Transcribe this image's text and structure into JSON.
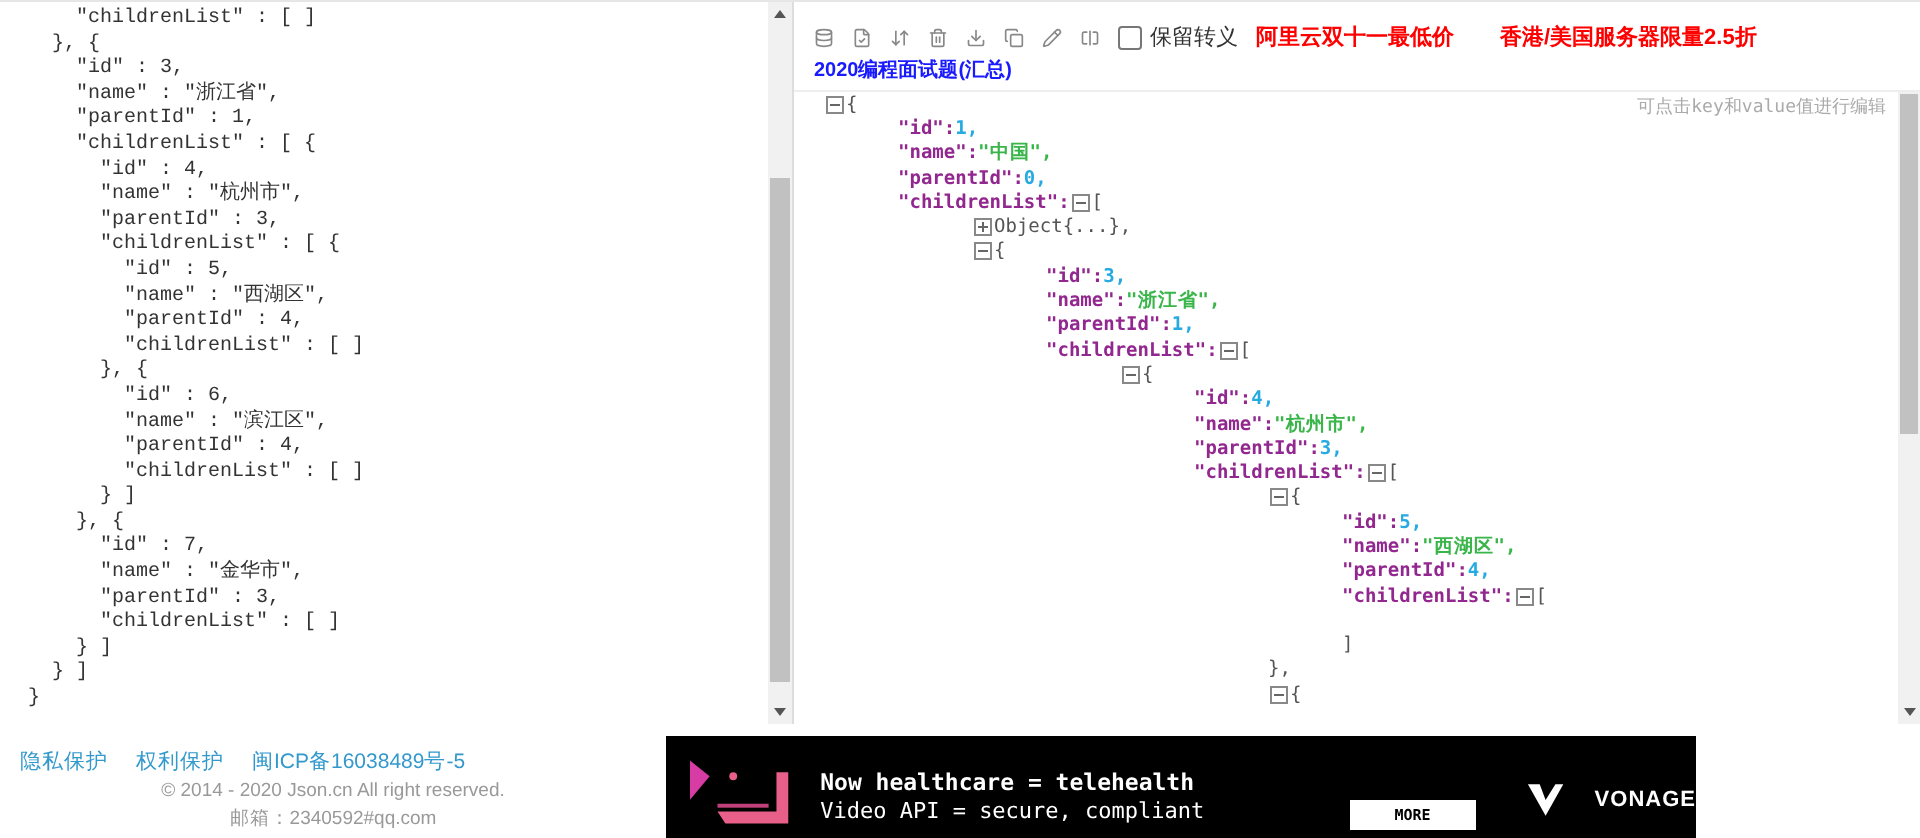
{
  "source_editor": {
    "lines": [
      "    \"childrenList\" : [ ]",
      "  }, {",
      "    \"id\" : 3,",
      "    \"name\" : \"浙江省\",",
      "    \"parentId\" : 1,",
      "    \"childrenList\" : [ {",
      "      \"id\" : 4,",
      "      \"name\" : \"杭州市\",",
      "      \"parentId\" : 3,",
      "      \"childrenList\" : [ {",
      "        \"id\" : 5,",
      "        \"name\" : \"西湖区\",",
      "        \"parentId\" : 4,",
      "        \"childrenList\" : [ ]",
      "      }, {",
      "        \"id\" : 6,",
      "        \"name\" : \"滨江区\",",
      "        \"parentId\" : 4,",
      "        \"childrenList\" : [ ]",
      "      } ]",
      "    }, {",
      "      \"id\" : 7,",
      "      \"name\" : \"金华市\",",
      "      \"parentId\" : 3,",
      "      \"childrenList\" : [ ]",
      "    } ]",
      "  } ]",
      "}"
    ]
  },
  "viewer": {
    "toolbar": {
      "keep_escape": {
        "label": "保留转义",
        "checked": false
      },
      "promo_links": [
        {
          "text": "阿里云双十一最低价"
        },
        {
          "text": "香港/美国服务器限量2.5折"
        }
      ],
      "article_link": "2020编程面试题(汇总)"
    },
    "hint": "可点击key和value值进行编辑",
    "tree": {
      "kind": "branch",
      "expanded": true,
      "open": "{",
      "children": [
        {
          "kind": "pair",
          "key": "\"id\":",
          "value": "1,",
          "color": "#25aae2"
        },
        {
          "kind": "pair",
          "key": "\"name\":",
          "value": "\"中国\",",
          "color": "#3ab54a"
        },
        {
          "kind": "pair",
          "key": "\"parentId\":",
          "value": "0,",
          "color": "#25aae2"
        },
        {
          "kind": "branch",
          "key": "\"childrenList\":",
          "expanded": true,
          "open": "[",
          "children": [
            {
              "kind": "branch",
              "expanded": false,
              "open": "Object{...},"
            },
            {
              "kind": "branch",
              "expanded": true,
              "open": "{",
              "children": [
                {
                  "kind": "pair",
                  "key": "\"id\":",
                  "value": "3,",
                  "color": "#25aae2"
                },
                {
                  "kind": "pair",
                  "key": "\"name\":",
                  "value": "\"浙江省\",",
                  "color": "#3ab54a"
                },
                {
                  "kind": "pair",
                  "key": "\"parentId\":",
                  "value": "1,",
                  "color": "#25aae2"
                },
                {
                  "kind": "branch",
                  "key": "\"childrenList\":",
                  "expanded": true,
                  "open": "[",
                  "children": [
                    {
                      "kind": "branch",
                      "expanded": true,
                      "open": "{",
                      "children": [
                        {
                          "kind": "pair",
                          "key": "\"id\":",
                          "value": "4,",
                          "color": "#25aae2"
                        },
                        {
                          "kind": "pair",
                          "key": "\"name\":",
                          "value": "\"杭州市\",",
                          "color": "#3ab54a"
                        },
                        {
                          "kind": "pair",
                          "key": "\"parentId\":",
                          "value": "3,",
                          "color": "#25aae2"
                        },
                        {
                          "kind": "branch",
                          "key": "\"childrenList\":",
                          "expanded": true,
                          "open": "[",
                          "children": [
                            {
                              "kind": "branch",
                              "expanded": true,
                              "open": "{",
                              "close": "},",
                              "children": [
                                {
                                  "kind": "pair",
                                  "key": "\"id\":",
                                  "value": "5,",
                                  "color": "#25aae2"
                                },
                                {
                                  "kind": "pair",
                                  "key": "\"name\":",
                                  "value": "\"西湖区\",",
                                  "color": "#3ab54a"
                                },
                                {
                                  "kind": "pair",
                                  "key": "\"parentId\":",
                                  "value": "4,",
                                  "color": "#25aae2"
                                },
                                {
                                  "kind": "branch",
                                  "key": "\"childrenList\":",
                                  "expanded": true,
                                  "open": "[",
                                  "close": "]"
                                }
                              ]
                            },
                            {
                              "kind": "branch",
                              "expanded": true,
                              "open": "{"
                            }
                          ]
                        }
                      ]
                    }
                  ]
                }
              ]
            }
          ]
        }
      ]
    }
  },
  "footer": {
    "links": [
      {
        "text": "隐私保护"
      },
      {
        "text": "权利保护"
      },
      {
        "text": "闽ICP备16038489号-5"
      }
    ],
    "copyright": "© 2014 - 2020 Json.cn All right reserved.",
    "email": "邮箱：2340592#qq.com"
  },
  "ad": {
    "title": "Now healthcare = telehealth",
    "subtitle": "Video API = secure, compliant",
    "button": "MORE",
    "brand": "VONAGE"
  }
}
